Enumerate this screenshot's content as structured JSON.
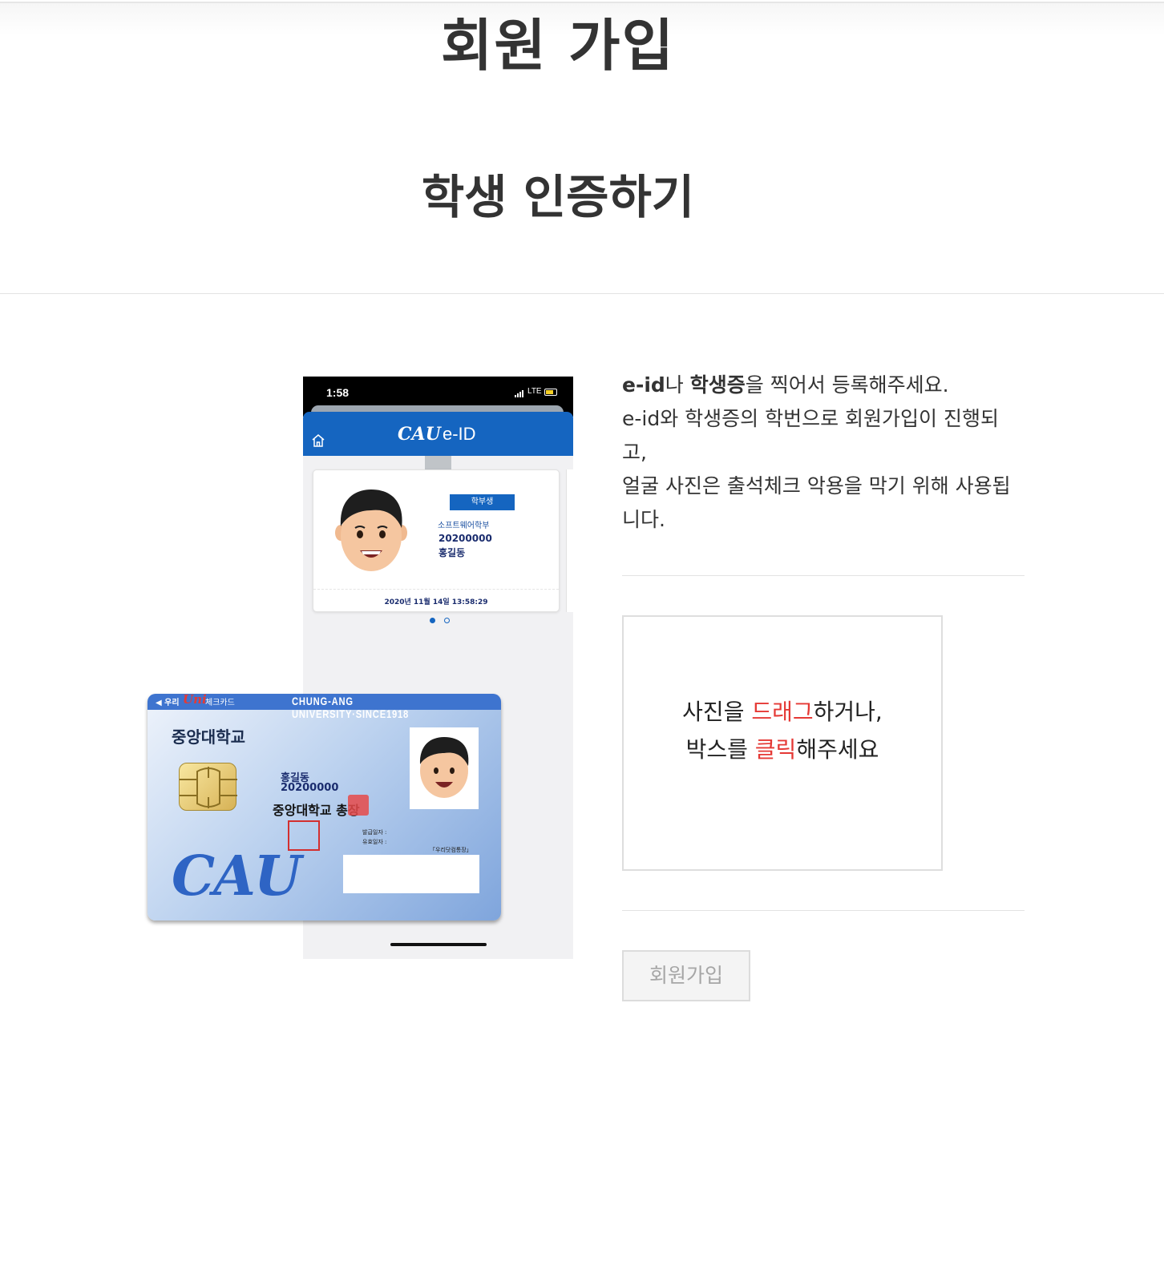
{
  "header": {
    "title": "회원 가입",
    "section_title": "학생 인증하기"
  },
  "phone": {
    "time": "1:58",
    "network": "LTE",
    "app_logo": "CAU",
    "app_name": "e-ID",
    "home_icon": "home-icon",
    "card": {
      "badge": "학부생",
      "department": "소프트웨어학부",
      "student_number": "20200000",
      "name": "홍길동",
      "timestamp": "2020년 11월 14일 13:58:29"
    }
  },
  "student_card": {
    "bank": "우리",
    "uni_mark": "Uni",
    "card_type": "체크카드",
    "english_banner": "CHUNG-ANG UNIVERSITY·SINCE1918",
    "school": "중앙대학교",
    "name": "홍길동",
    "student_number": "20200000",
    "president": "중앙대학교 총장",
    "issue_label": "발급일자 :",
    "expire_label": "유효일자 :",
    "account_label": "「우리닷컴통장」",
    "logo": "CAU"
  },
  "instructions": {
    "line1_bold_a": "e-id",
    "line1_mid": "나 ",
    "line1_bold_b": "학생증",
    "line1_rest": "을 찍어서 등록해주세요.",
    "line2": "e-id와 학생증의 학번으로 회원가입이 진행되고,",
    "line3": "얼굴 사진은 출석체크 악용을 막기 위해 사용됩니다."
  },
  "upload": {
    "line1_pre": "사진을 ",
    "line1_highlight": "드래그",
    "line1_post": "하거나,",
    "line2_pre": "박스를 ",
    "line2_highlight": "클릭",
    "line2_post": "해주세요"
  },
  "actions": {
    "signup_label": "회원가입"
  },
  "colors": {
    "brand_blue": "#1565c0",
    "highlight_red": "#e53935",
    "disabled_text": "#a6a6a6"
  }
}
